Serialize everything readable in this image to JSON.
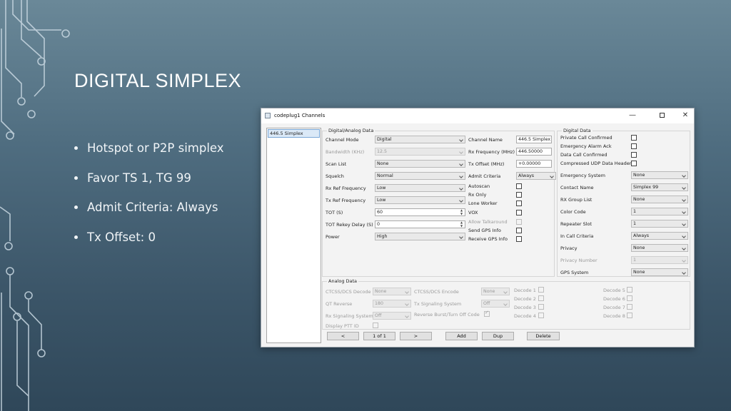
{
  "slide": {
    "title": "DIGITAL SIMPLEX",
    "bullets": [
      "Hotspot or P2P simplex",
      "Favor TS 1, TG 99",
      "Admit Criteria: Always",
      "Tx Offset: 0"
    ]
  },
  "window": {
    "title": "codeplug1 Channels",
    "controls": {
      "minimize": "—",
      "close": "✕"
    },
    "channel_list": [
      "446.5 Simplex"
    ],
    "digital_analog": {
      "legend": "Digital/Analog Data",
      "channel_mode_label": "Channel Mode",
      "channel_mode": "Digital",
      "bandwidth_label": "Bandwidth (KHz)",
      "bandwidth": "12.5",
      "scan_list_label": "Scan List",
      "scan_list": "None",
      "squelch_label": "Squelch",
      "squelch": "Normal",
      "rx_ref_label": "Rx Ref Frequency",
      "rx_ref": "Low",
      "tx_ref_label": "Tx Ref Frequency",
      "tx_ref": "Low",
      "tot_label": "TOT (S)",
      "tot": "60",
      "tot_rekey_label": "TOT Rekey Delay (S)",
      "tot_rekey": "0",
      "power_label": "Power",
      "power": "High",
      "channel_name_label": "Channel Name",
      "channel_name": "446.5 Simplex",
      "rx_freq_label": "Rx Frequency (MHz)",
      "rx_freq": "446.50000",
      "tx_offset_label": "Tx Offset (MHz)",
      "tx_offset": "+0.00000",
      "admit_label": "Admit Criteria",
      "admit": "Always",
      "autoscan_label": "Autoscan",
      "rx_only_label": "Rx Only",
      "lone_worker_label": "Lone Worker",
      "vox_label": "VOX",
      "allow_talkaround_label": "Allow Talkaround",
      "send_gps_label": "Send GPS Info",
      "receive_gps_label": "Receive GPS Info"
    },
    "digital": {
      "legend": "Digital Data",
      "private_call_label": "Private Call Confirmed",
      "emergency_ack_label": "Emergency Alarm Ack",
      "data_call_label": "Data Call Confirmed",
      "compressed_udp_label": "Compressed UDP Data Header",
      "emergency_system_label": "Emergency System",
      "emergency_system": "None",
      "contact_name_label": "Contact Name",
      "contact_name": "Simplex 99",
      "rx_group_label": "RX Group List",
      "rx_group": "None",
      "color_code_label": "Color Code",
      "color_code": "1",
      "repeater_slot_label": "Repeater Slot",
      "repeater_slot": "1",
      "in_call_label": "In Call Criteria",
      "in_call": "Always",
      "privacy_label": "Privacy",
      "privacy": "None",
      "privacy_number_label": "Privacy Number",
      "privacy_number": "1",
      "gps_system_label": "GPS System",
      "gps_system": "None"
    },
    "analog": {
      "legend": "Analog Data",
      "ctcss_decode_label": "CTCSS/DCS Decode",
      "ctcss_decode": "None",
      "ctcss_encode_label": "CTCSS/DCS Encode",
      "ctcss_encode": "None",
      "qt_reverse_label": "QT Reverse",
      "qt_reverse": "180",
      "tx_signaling_label": "Tx Signaling System",
      "tx_signaling": "Off",
      "rx_signaling_label": "Rx Signaling System",
      "rx_signaling": "Off",
      "reverse_burst_label": "Reverse Burst/Turn Off Code",
      "display_ptt_label": "Display PTT ID",
      "decodes": [
        "Decode 1",
        "Decode 2",
        "Decode 3",
        "Decode 4",
        "Decode 5",
        "Decode 6",
        "Decode 7",
        "Decode 8"
      ]
    },
    "buttons": {
      "prev": "<",
      "page": "1 of 1",
      "next": ">",
      "add": "Add",
      "dup": "Dup",
      "delete": "Delete"
    }
  }
}
